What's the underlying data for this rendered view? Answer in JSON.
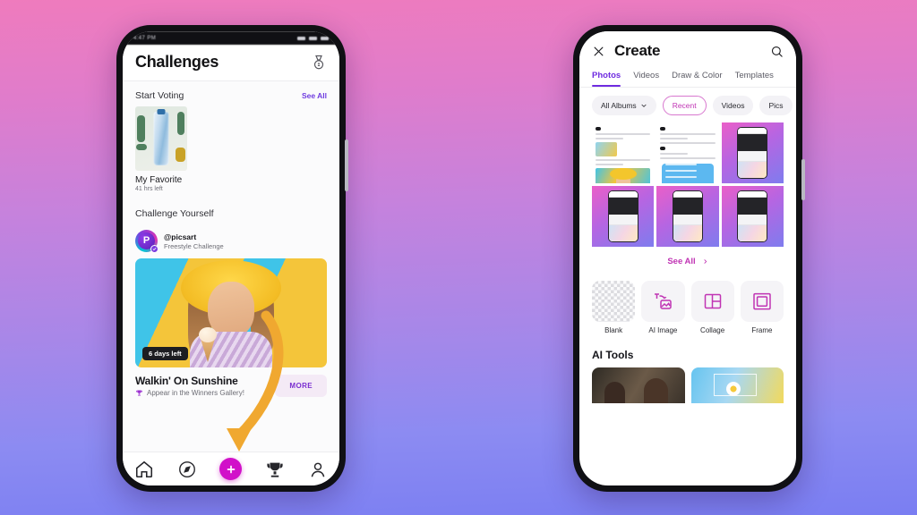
{
  "background": {
    "top_color": "#ef7bbd",
    "bottom_color": "#7a7ef2"
  },
  "left_phone": {
    "status_bar": {
      "time": "4:47 PM",
      "right_glyphs": "..."
    },
    "header": {
      "title": "Challenges",
      "medal_icon": "medal-icon"
    },
    "start_voting": {
      "section_title": "Start Voting",
      "see_all": "See All",
      "card": {
        "name": "My Favorite",
        "time_left": "41 hrs left",
        "thumb_alt": "water-bottle-photo"
      }
    },
    "challenge_yourself": {
      "section_title": "Challenge Yourself",
      "user_handle": "@picsart",
      "user_subtitle": "Freestyle Challenge",
      "avatar_letter": "P",
      "badge": "6 days left",
      "title": "Walkin' On Sunshine",
      "subtitle": "Appear in the Winners Gallery!",
      "more_button": "MORE",
      "trophy_icon": "trophy-icon"
    },
    "bottom_nav": [
      {
        "name": "home-icon",
        "active": false
      },
      {
        "name": "discover-icon",
        "active": false
      },
      {
        "name": "create-fab-icon",
        "active": false
      },
      {
        "name": "trophy-icon",
        "active": true
      },
      {
        "name": "profile-icon",
        "active": false
      }
    ],
    "fab_color": "#d111c9"
  },
  "right_phone": {
    "header": {
      "close_icon": "close-icon",
      "title": "Create",
      "search_icon": "search-icon"
    },
    "tabs": [
      {
        "label": "Photos",
        "active": true
      },
      {
        "label": "Videos",
        "active": false
      },
      {
        "label": "Draw & Color",
        "active": false
      },
      {
        "label": "Templates",
        "active": false
      }
    ],
    "chips": [
      {
        "label": "All Albums",
        "active": false,
        "has_caret": true
      },
      {
        "label": "Recent",
        "active": true,
        "has_caret": false
      },
      {
        "label": "Videos",
        "active": false,
        "has_caret": false
      },
      {
        "label": "Pics",
        "active": false,
        "has_caret": false
      }
    ],
    "photo_grid": [
      {
        "kind": "document",
        "alt": "document-thumbnail"
      },
      {
        "kind": "notes",
        "alt": "notes-screenshot"
      },
      {
        "kind": "screenshot",
        "alt": "app-screenshot"
      },
      {
        "kind": "screenshot",
        "alt": "app-screenshot"
      },
      {
        "kind": "screenshot",
        "alt": "app-screenshot"
      },
      {
        "kind": "screenshot",
        "alt": "app-screenshot"
      }
    ],
    "see_all": "See All",
    "tools": [
      {
        "label": "Blank",
        "icon": "checkerboard-icon"
      },
      {
        "label": "AI Image",
        "icon": "ai-image-icon"
      },
      {
        "label": "Collage",
        "icon": "collage-icon"
      },
      {
        "label": "Frame",
        "icon": "frame-icon"
      }
    ],
    "ai_tools": {
      "title": "AI Tools",
      "cards": [
        {
          "alt": "portrait-photo-card"
        },
        {
          "alt": "flower-selection-card"
        }
      ]
    },
    "accent_color": "#c034b4",
    "tab_accent_color": "#6f2ce0"
  }
}
